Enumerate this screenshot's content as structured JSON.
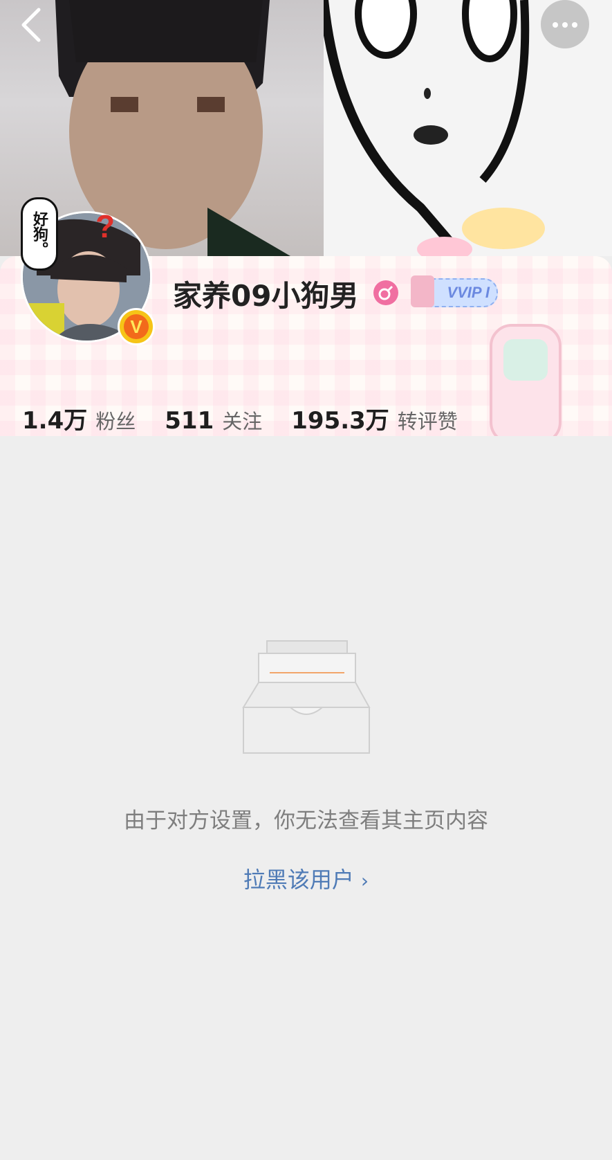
{
  "header": {
    "back_icon": "chevron-left-icon",
    "more_icon": "more-dots-icon"
  },
  "profile": {
    "avatar_bubble_text": "好狗。",
    "avatar_mark": "?",
    "verified_mark": "V",
    "username": "家养09小狗男",
    "gender_icon": "female-icon",
    "vip_label": "VVIP I"
  },
  "stats": [
    {
      "value": "1.4万",
      "label": "粉丝"
    },
    {
      "value": "511",
      "label": "关注"
    },
    {
      "value": "195.3万",
      "label": "转评赞"
    }
  ],
  "content": {
    "empty_icon": "empty-box-icon",
    "notice": "由于对方设置，你无法查看其主页内容",
    "block_link": "拉黑该用户",
    "block_link_chevron": "›"
  },
  "colors": {
    "link": "#4f7bb6",
    "background": "#eeeeee"
  }
}
